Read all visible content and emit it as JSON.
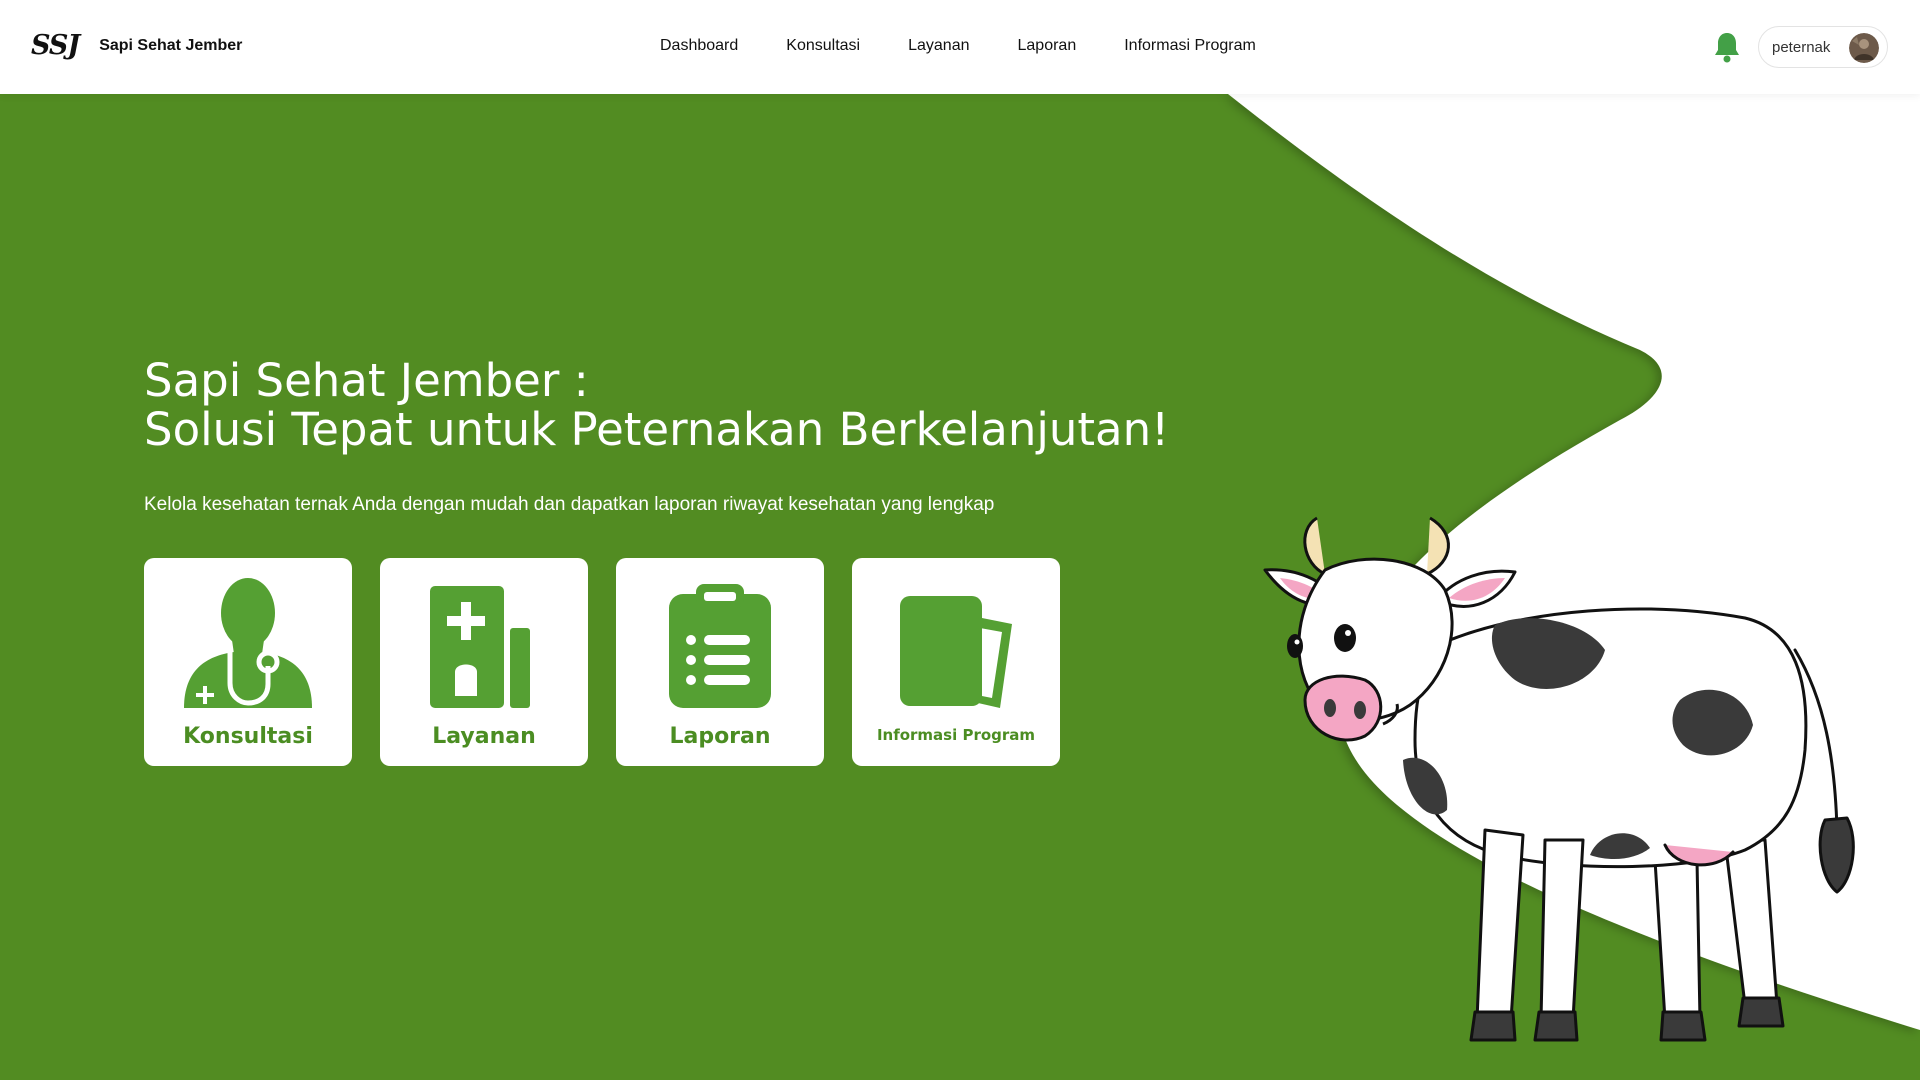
{
  "brand": {
    "logo": "SSJ",
    "name": "Sapi Sehat Jember"
  },
  "nav": {
    "items": [
      "Dashboard",
      "Konsultasi",
      "Layanan",
      "Laporan",
      "Informasi Program"
    ]
  },
  "user": {
    "name": "peternak",
    "avatar_icon": "user-avatar-photo"
  },
  "notification_icon": "bell-icon",
  "hero": {
    "title_line1": "Sapi Sehat Jember :",
    "title_line2": "Solusi Tepat untuk Peternakan Berkelanjutan!",
    "subtitle": "Kelola kesehatan ternak Anda dengan mudah dan dapatkan laporan riwayat kesehatan yang lengkap"
  },
  "cards": [
    {
      "label": "Konsultasi",
      "icon": "doctor-icon"
    },
    {
      "label": "Layanan",
      "icon": "hospital-icon"
    },
    {
      "label": "Laporan",
      "icon": "clipboard-list-icon"
    },
    {
      "label": "Informasi Program",
      "icon": "documents-icon"
    }
  ],
  "colors": {
    "primary_green": "#528c22",
    "icon_green": "#55a033",
    "label_green": "#4b8d22",
    "white": "#ffffff"
  }
}
